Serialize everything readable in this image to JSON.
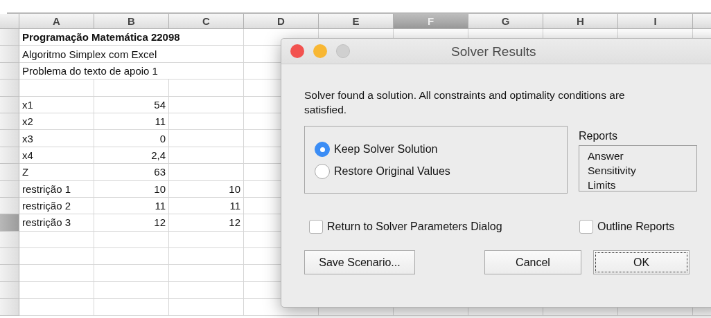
{
  "spreadsheet": {
    "columns": [
      {
        "label": "A",
        "selected": false
      },
      {
        "label": "B",
        "selected": false
      },
      {
        "label": "C",
        "selected": false
      },
      {
        "label": "D",
        "selected": false
      },
      {
        "label": "E",
        "selected": false
      },
      {
        "label": "F",
        "selected": true
      },
      {
        "label": "G",
        "selected": false
      },
      {
        "label": "H",
        "selected": false
      },
      {
        "label": "I",
        "selected": false
      }
    ],
    "rows": [
      {
        "kind": "title",
        "text": "Programação Matemática 22098",
        "selected": false
      },
      {
        "kind": "text",
        "text": "Algoritmo Simplex com Excel",
        "selected": false
      },
      {
        "kind": "text",
        "text": "Problema do texto de apoio 1",
        "selected": false
      },
      {
        "kind": "empty",
        "selected": false
      },
      {
        "kind": "data",
        "a": "x1",
        "b": "54",
        "selected": false
      },
      {
        "kind": "data",
        "a": "x2",
        "b": "11",
        "selected": false
      },
      {
        "kind": "data",
        "a": "x3",
        "b": "0",
        "selected": false
      },
      {
        "kind": "data",
        "a": "x4",
        "b": "2,4",
        "selected": false
      },
      {
        "kind": "data",
        "a": "Z",
        "b": "63",
        "selected": false
      },
      {
        "kind": "data",
        "a": "restrição 1",
        "b": "10",
        "c": "10",
        "selected": false
      },
      {
        "kind": "data",
        "a": "restrição 2",
        "b": "11",
        "c": "11",
        "selected": false
      },
      {
        "kind": "data",
        "a": "restrição 3",
        "b": "12",
        "c": "12",
        "selected": true
      },
      {
        "kind": "empty",
        "selected": false
      },
      {
        "kind": "empty",
        "selected": false
      },
      {
        "kind": "empty",
        "selected": false
      },
      {
        "kind": "empty",
        "selected": false
      },
      {
        "kind": "empty",
        "selected": false
      }
    ]
  },
  "dialog": {
    "title": "Solver Results",
    "message": "Solver found a solution.  All constraints and optimality conditions are satisfied.",
    "options": [
      {
        "label": "Keep Solver Solution",
        "selected": true
      },
      {
        "label": "Restore Original Values",
        "selected": false
      }
    ],
    "reports_label": "Reports",
    "reports": [
      "Answer",
      "Sensitivity",
      "Limits"
    ],
    "return_checkbox": {
      "label": "Return to Solver Parameters Dialog",
      "checked": false
    },
    "outline_checkbox": {
      "label": "Outline Reports",
      "checked": false
    },
    "buttons": [
      {
        "label": "Save Scenario...",
        "default": false
      },
      {
        "label": "Cancel",
        "default": false
      },
      {
        "label": "OK",
        "default": true
      }
    ]
  }
}
